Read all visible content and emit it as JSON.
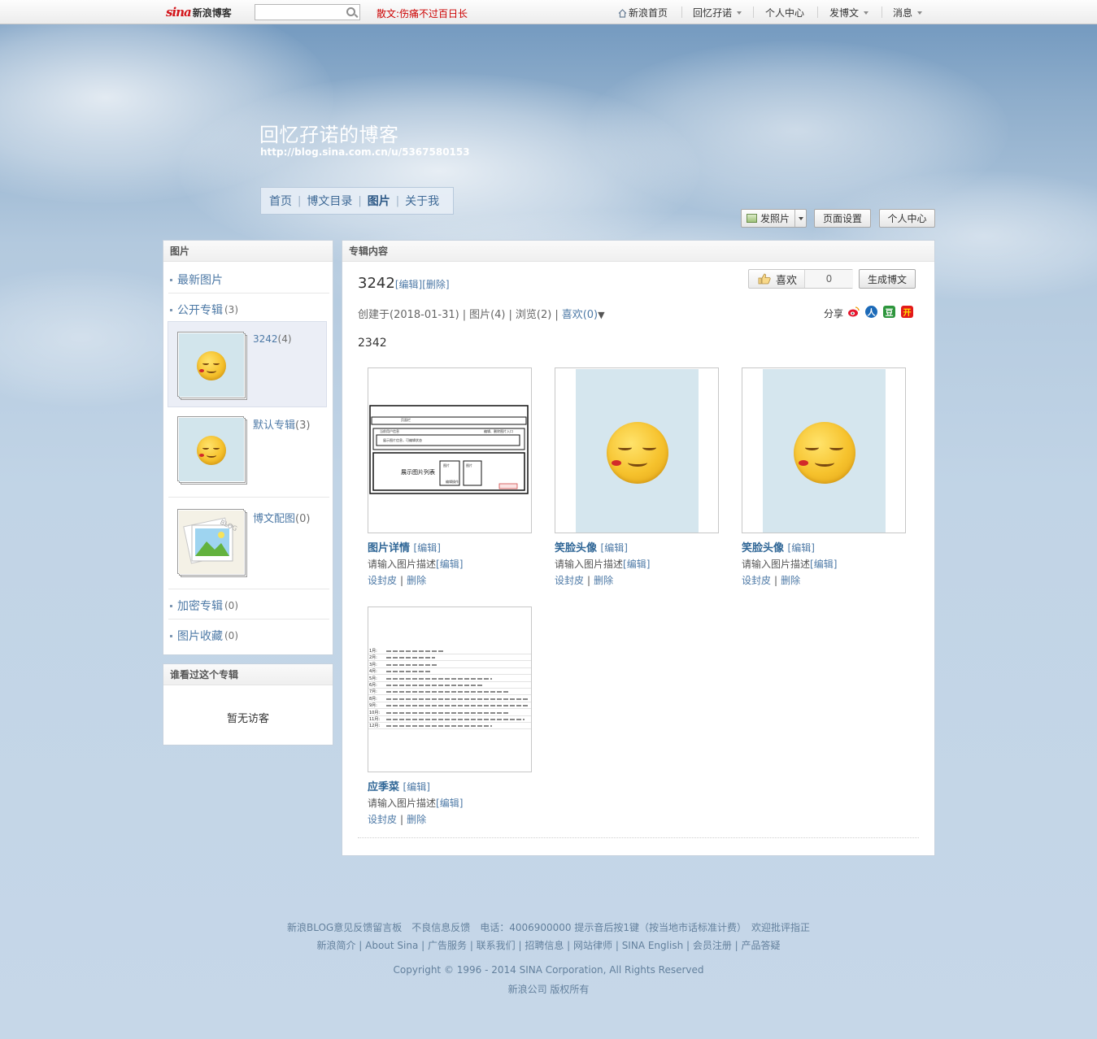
{
  "topbar": {
    "logo_mark": "sina",
    "logo_text": "新浪博客",
    "search_placeholder": "",
    "hot_label": "散文:",
    "hot_text": "伤痛不过百日长",
    "nav": {
      "home": "新浪首页",
      "user": "回忆孖诺",
      "center": "个人中心",
      "post": "发博文",
      "msg": "消息"
    },
    "icons": [
      "search-icon",
      "home-icon"
    ]
  },
  "blog": {
    "title": "回忆孖诺的博客",
    "url": "http://blog.sina.com.cn/u/5367580153",
    "nav": [
      "首页",
      "博文目录",
      "图片",
      "关于我"
    ],
    "active_nav": "图片"
  },
  "actions": {
    "upload": "发照片",
    "page_settings": "页面设置",
    "personal_center": "个人中心"
  },
  "sidebar": {
    "header": "图片",
    "latest": "最新图片",
    "public_label": "公开专辑",
    "public_count": "(3)",
    "albums": [
      {
        "name": "3242",
        "count": "(4)"
      },
      {
        "name": "默认专辑",
        "count": "(3)"
      },
      {
        "name": "博文配图",
        "count": "(0)"
      }
    ],
    "private_label": "加密专辑",
    "private_count": "(0)",
    "fav_label": "图片收藏",
    "fav_count": "(0)"
  },
  "visitors": {
    "header": "谁看过这个专辑",
    "empty": "暂无访客"
  },
  "main": {
    "header": "专辑内容",
    "album_title": "3242",
    "edit": "[编辑]",
    "delete": "[删除]",
    "like_label": "喜欢",
    "like_count": "0",
    "generate": "生成博文",
    "meta_created": "创建于(2018-01-31)",
    "meta_pics": "图片(4)",
    "meta_views": "浏览(2)",
    "meta_likes": "喜欢(0)",
    "share_label": "分享",
    "description": "2342",
    "photos": [
      {
        "title": "图片详情",
        "edit": "[编辑]",
        "desc": "请输入图片描述",
        "desc_edit": "[编辑]",
        "cover": "设封皮",
        "del": "删除"
      },
      {
        "title": "笑脸头像",
        "edit": "[编辑]",
        "desc": "请输入图片描述",
        "desc_edit": "[编辑]",
        "cover": "设封皮",
        "del": "删除"
      },
      {
        "title": "笑脸头像",
        "edit": "[编辑]",
        "desc": "请输入图片描述",
        "desc_edit": "[编辑]",
        "cover": "设封皮",
        "del": "删除"
      },
      {
        "title": "应季菜",
        "edit": "[编辑]",
        "desc": "请输入图片描述",
        "desc_edit": "[编辑]",
        "cover": "设封皮",
        "del": "删除"
      }
    ],
    "wireframe_labels": {
      "top": "页面栏",
      "row1_left": "当前用户信息",
      "row1_right": "编辑、删除图片入口",
      "row2": "展示图片信息，可编辑状态",
      "list": "展示图片列表",
      "pic1": "图片",
      "pic2": "图片",
      "pic_op": "编辑操作"
    },
    "veg_months": [
      "1月:",
      "2月:",
      "3月:",
      "4月:",
      "5月:",
      "6月:",
      "7月:",
      "8月:",
      "9月:",
      "10月:",
      "11月:",
      "12月:"
    ]
  },
  "footer": {
    "line1": "新浪BLOG意见反馈留言板　不良信息反馈　电话：4006900000 提示音后按1键（按当地市话标准计费）　欢迎批评指正",
    "line2": "新浪简介 | About Sina | 广告服务 | 联系我们 | 招聘信息 | 网站律师 | SINA English | 会员注册 | 产品答疑",
    "line3": "Copyright © 1996 - 2014 SINA Corporation, All Rights Reserved",
    "line4": "新浪公司 版权所有"
  },
  "colors": {
    "accent_link": "#4d79a6",
    "hot_red": "#cc0000",
    "sky_blue": "#b3c9de"
  }
}
